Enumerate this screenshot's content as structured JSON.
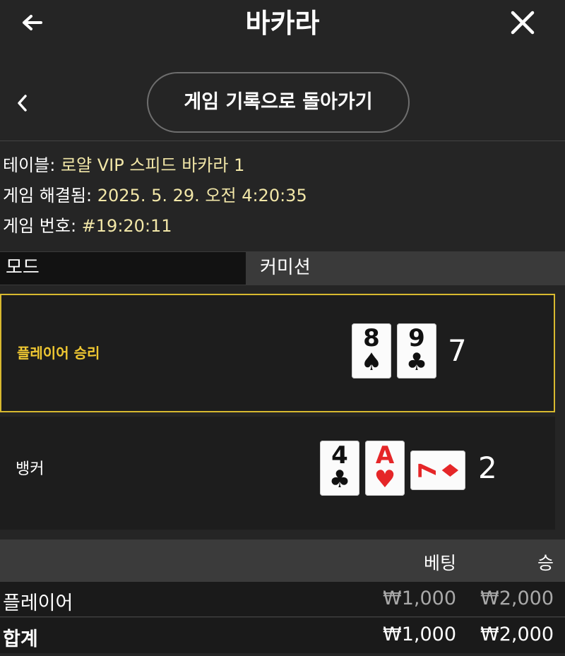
{
  "header": {
    "title": "바카라",
    "back_icon": "arrow-left-icon",
    "close_icon": "close-icon"
  },
  "subnav": {
    "chevron_icon": "chevron-left-icon",
    "history_button": "게임 기록으로 돌아가기"
  },
  "info": {
    "table_label": "테이블: ",
    "table_value": "로얄 VIP 스피드 바카라 1",
    "time_label": "게임 해결됨: ",
    "time_value": "2025. 5. 29. 오전 4:20:35",
    "num_label": "게임 번호: ",
    "num_value": "#19:20:11"
  },
  "mode": {
    "label": "모드",
    "value": "커미션"
  },
  "player": {
    "label": "플레이어 승리",
    "score": "7",
    "cards": [
      {
        "rank": "8",
        "suit": "♠",
        "color": "black"
      },
      {
        "rank": "9",
        "suit": "♣",
        "color": "black"
      }
    ]
  },
  "banker": {
    "label": "뱅커",
    "score": "2",
    "cards": [
      {
        "rank": "4",
        "suit": "♣",
        "color": "black"
      },
      {
        "rank": "A",
        "suit": "♥",
        "color": "red"
      },
      {
        "rank": "7",
        "suit": "♦",
        "color": "red",
        "rotated": true
      }
    ]
  },
  "bets": {
    "header": {
      "bet": "베팅",
      "win": "승"
    },
    "rows": [
      {
        "label": "플레이어",
        "bet": "₩1,000",
        "win": "₩2,000"
      },
      {
        "label": "합계",
        "bet": "₩1,000",
        "win": "₩2,000"
      }
    ]
  },
  "colors": {
    "accent": "#d8b92f",
    "background": "#252525",
    "red_suit": "#e52628"
  }
}
